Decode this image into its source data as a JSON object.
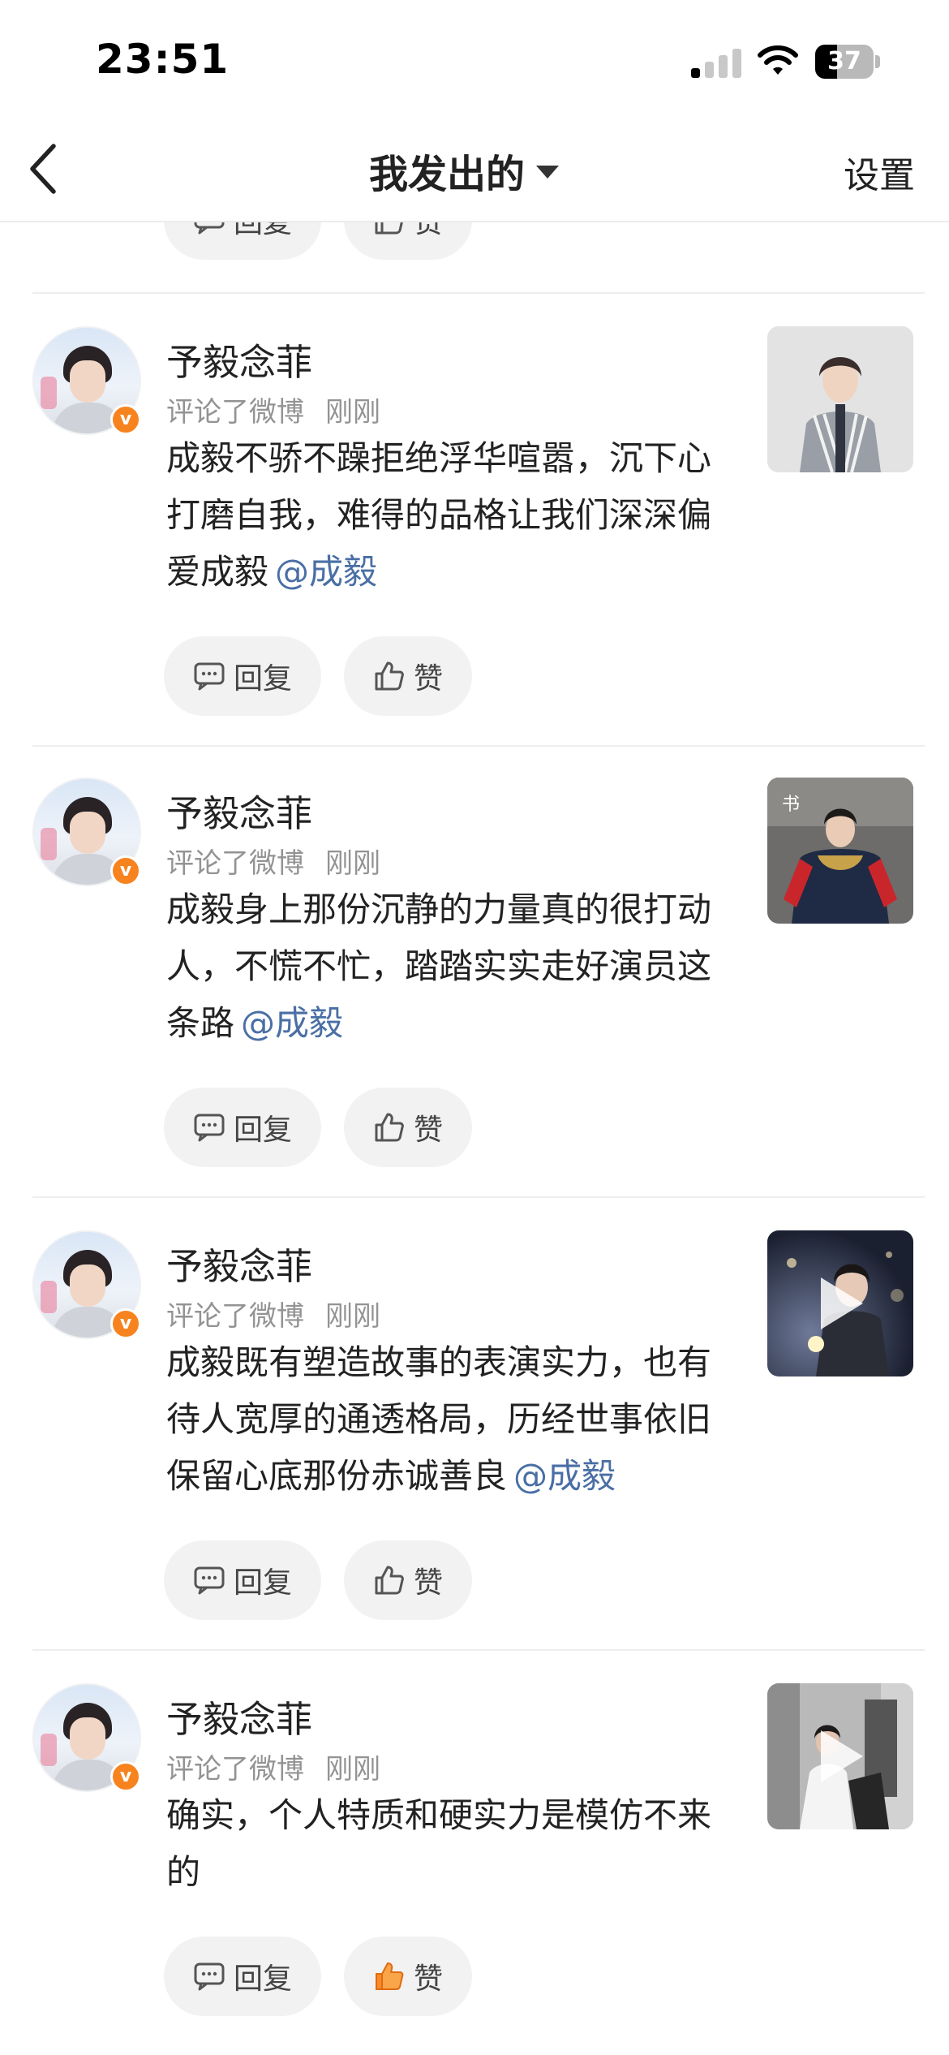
{
  "status_bar": {
    "time": "23:51",
    "battery": "37",
    "battery_level": 0.37,
    "signal_bars_active": 1
  },
  "nav": {
    "title": "我发出的",
    "settings_label": "设置"
  },
  "actions": {
    "reply_label": "回复",
    "like_label": "赞"
  },
  "feed": [
    {
      "user": "予毅念菲",
      "action": "评论了微博",
      "time": "刚刚",
      "text": "成毅不骄不躁拒绝浮华喧嚣，沉下心打磨自我，难得的品格让我们深深偏爱成毅",
      "mention": "@成毅",
      "thumb": "photo-man-striped-shirt",
      "is_video": false,
      "liked": false
    },
    {
      "user": "予毅念菲",
      "action": "评论了微博",
      "time": "刚刚",
      "text": "成毅身上那份沉静的力量真的很打动人，不慌不忙，踏踏实实走好演员这条路",
      "mention": "@成毅",
      "thumb": "photo-costume-drama",
      "is_video": false,
      "liked": false
    },
    {
      "user": "予毅念菲",
      "action": "评论了微博",
      "time": "刚刚",
      "text": "成毅既有塑造故事的表演实力，也有待人宽厚的通透格局，历经世事依旧保留心底那份赤诚善良",
      "mention": "@成毅",
      "thumb": "video-night-sparkler",
      "is_video": true,
      "liked": false
    },
    {
      "user": "予毅念菲",
      "action": "评论了微博",
      "time": "刚刚",
      "text": "确实，个人特质和硬实力是模仿不来的",
      "mention": "",
      "thumb": "video-street-scene",
      "is_video": true,
      "liked": true
    }
  ],
  "colors": {
    "accent_orange": "#f7831f",
    "mention_blue": "#4a6fa5",
    "like_orange": "#f78a2a"
  }
}
